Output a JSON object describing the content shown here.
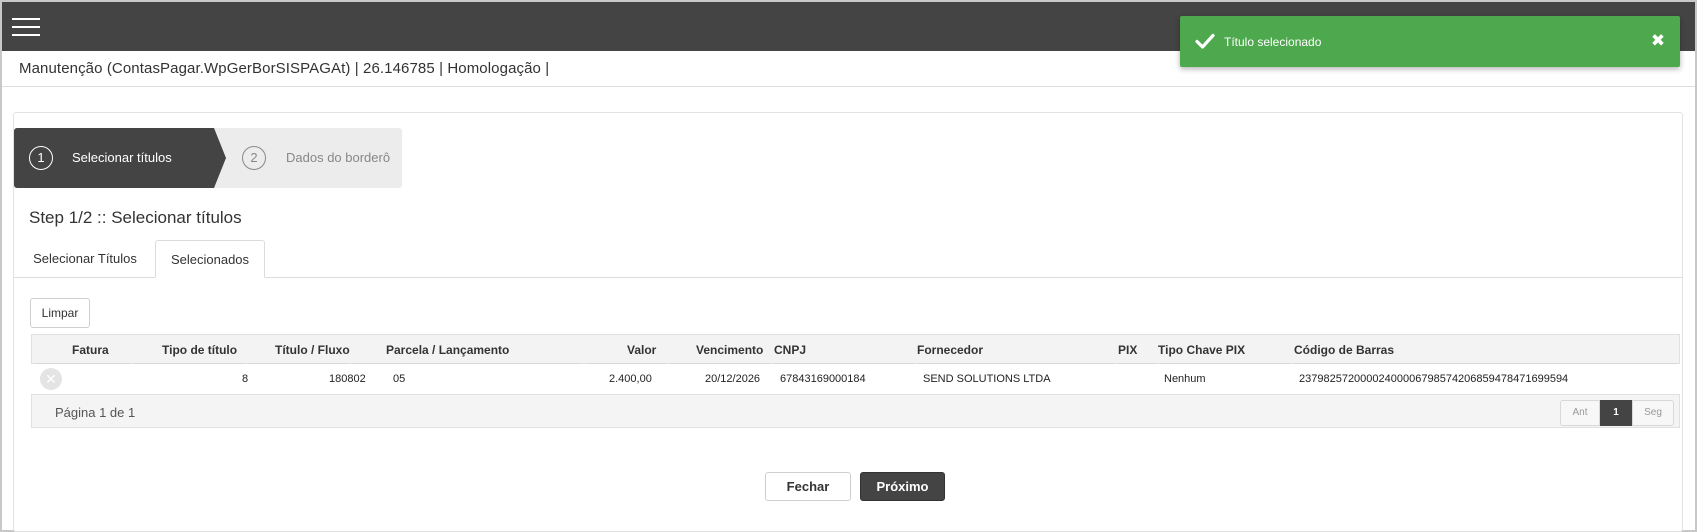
{
  "header": {
    "menu_icon": "hamburger-menu-icon",
    "breadcrumb": "Manutenção (ContasPagar.WpGerBorSISPAGAt) | 26.146785 | Homologação |"
  },
  "toast": {
    "message": "Título selecionado",
    "check_icon": "check-icon",
    "close_icon": "close-icon",
    "close_glyph": "✖",
    "color": "#4ea84e"
  },
  "wizard": {
    "steps": [
      {
        "number": "1",
        "label": "Selecionar títulos",
        "active": true
      },
      {
        "number": "2",
        "label": "Dados do borderô",
        "active": false
      }
    ]
  },
  "step_title": "Step 1/2 :: Selecionar títulos",
  "tabs": [
    {
      "label": "Selecionar Títulos",
      "active": false
    },
    {
      "label": "Selecionados",
      "active": true
    }
  ],
  "limpar_label": "Limpar",
  "table": {
    "columns": [
      "Fatura",
      "Tipo de título",
      "Título / Fluxo",
      "Parcela / Lançamento",
      "Valor",
      "Vencimento",
      "CNPJ",
      "Fornecedor",
      "PIX",
      "Tipo Chave PIX",
      "Código de Barras"
    ],
    "rows": [
      {
        "remove_icon": "remove-circle-icon",
        "remove_glyph": "✕",
        "fatura": "",
        "tipo_titulo": "8",
        "titulo_fluxo": "180802",
        "parcela": "05",
        "valor": "2.400,00",
        "vencimento": "20/12/2026",
        "cnpj": "67843169000184",
        "fornecedor": "SEND SOLUTIONS LTDA",
        "pix": "",
        "tipo_chave_pix": "Nenhum",
        "codigo_barras": "23798257200002400006798574206859478471699594"
      }
    ],
    "page_info": "Página 1 de 1",
    "pager": {
      "prev": "Ant",
      "current": "1",
      "next": "Seg"
    }
  },
  "footer": {
    "close_label": "Fechar",
    "next_label": "Próximo"
  },
  "colors": {
    "topbar": "#444444",
    "accent_dark": "#444444",
    "toast_success": "#4ea84e"
  }
}
